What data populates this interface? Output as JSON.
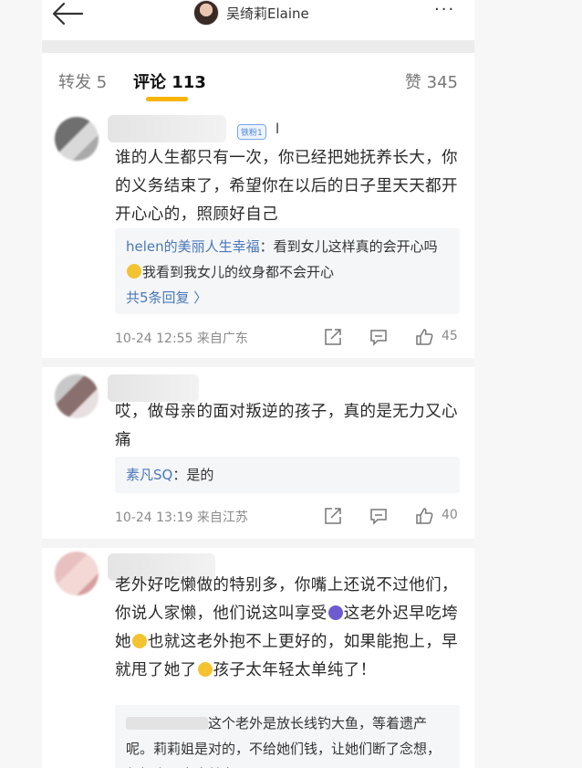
{
  "header": {
    "back_icon": "arrow-left-icon",
    "user_name": "吴绮莉Elaine",
    "more_label": "···"
  },
  "tabs": {
    "repost": "转发 5",
    "comments": "评论 113",
    "likes": "赞 345",
    "accent_color": "#f7b400"
  },
  "comments": [
    {
      "badge": "铁粉1",
      "name_tail": "l",
      "text": "谁的人生都只有一次，你已经把她抚养长大，你的义务结束了，希望你在以后的日子里天天都开开心心的，照顾好自己",
      "reply_name": "helen的美丽人生幸福",
      "reply_text_1": "：看到女儿这样真的会开心吗",
      "reply_text_2": "我看到我女儿的纹身都不会开心",
      "reply_more": "共5条回复 〉",
      "time": "10-24 12:55  来自广东",
      "likes": "45"
    },
    {
      "text": "哎，做母亲的面对叛逆的孩子，真的是无力又心痛",
      "reply_name": "素凡SQ",
      "reply_text_1": "：是的",
      "time": "10-24 13:19  来自江苏",
      "likes": "40"
    },
    {
      "text_1": "老外好吃懒做的特别多，你嘴上还说不过他们，你说人家懒，他们说这叫享受",
      "text_2": "这老外迟早吃垮她",
      "text_3": "也就这老外抱不上更好的，如果能抱上，早就甩了她了",
      "text_4": "孩子太年轻太单纯了！",
      "reply_text_1": "这个老外是放长线钓大鱼，等着遗产呢。莉莉姐是对的，不给她们钱，让她们断了念想，年轻人要自食其力"
    }
  ]
}
